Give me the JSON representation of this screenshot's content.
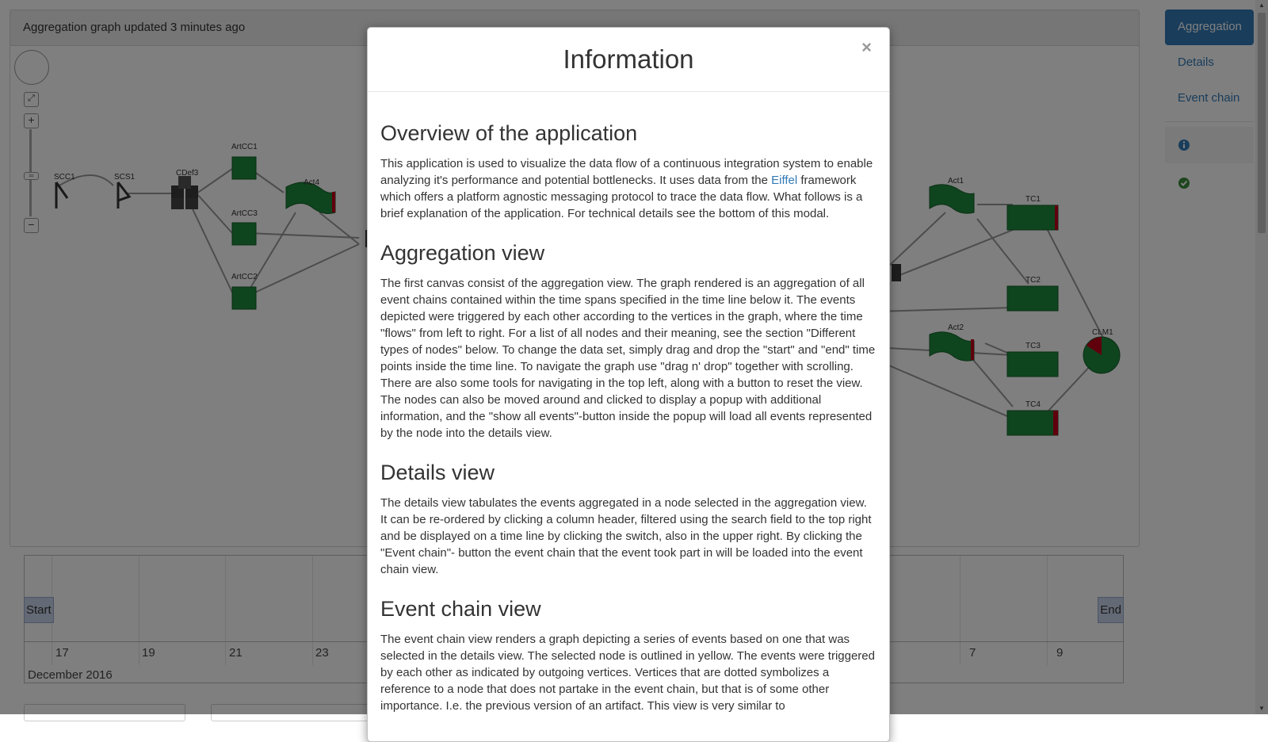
{
  "aggregation_panel": {
    "status": "Aggregation graph updated 3 minutes ago"
  },
  "graph_nodes": {
    "scc1": "SCC1",
    "scs1": "SCS1",
    "cdef3": "CDef3",
    "artcc1": "ArtCC1",
    "artcc3": "ArtCC3",
    "artcc2": "ArtCC2",
    "act4": "Act4",
    "act1": "Act1",
    "act2": "Act2",
    "tc1": "TC1",
    "tc2": "TC2",
    "tc3": "TC3",
    "tc4": "TC4",
    "clm1": "CLM1"
  },
  "timeline": {
    "start_label": "Start",
    "end_label": "End",
    "ticks": [
      "17",
      "19",
      "21",
      "23",
      "7",
      "9"
    ],
    "month": "December 2016"
  },
  "sidebar": {
    "items": [
      {
        "label": "Aggregation",
        "active": true
      },
      {
        "label": "Details",
        "active": false
      },
      {
        "label": "Event chain",
        "active": false
      }
    ],
    "icons": [
      "info-icon",
      "check-circle-icon"
    ]
  },
  "modal": {
    "title": "Information",
    "close": "×",
    "sections": [
      {
        "heading": "Overview of the application",
        "text_before_link": "This application is used to visualize the data flow of a continuous integration system to enable analyzing it's performance and potential bottlenecks. It uses data from the ",
        "link": "Eiffel",
        "text_after_link": " framework which offers a platform agnostic messaging protocol to trace the data flow. What follows is a brief explanation of the application. For technical details see the bottom of this modal."
      },
      {
        "heading": "Aggregation view",
        "text": "The first canvas consist of the aggregation view. The graph rendered is an aggregation of all event chains contained within the time spans specified in the time line below it. The events depicted were triggered by each other according to the vertices in the graph, where the time \"flows\" from left to right. For a list of all nodes and their meaning, see the section \"Different types of nodes\" below. To change the data set, simply drag and drop the \"start\" and \"end\" time points inside the time line. To navigate the graph use \"drag n' drop\" together with scrolling. There are also some tools for navigating in the top left, along with a button to reset the view. The nodes can also be moved around and clicked to display a popup with additional information, and the \"show all events\"-button inside the popup will load all events represented by the node into the details view."
      },
      {
        "heading": "Details view",
        "text": "The details view tabulates the events aggregated in a node selected in the aggregation view. It can be re-ordered by clicking a column header, filtered using the search field to the top right and be displayed on a time line by clicking the switch, also in the upper right. By clicking the \"Event chain\"- button the event chain that the event took part in will be loaded into the event chain view."
      },
      {
        "heading": "Event chain view",
        "text": "The event chain view renders a graph depicting a series of events based on one that was selected in the details view. The selected node is outlined in yellow. The events were triggered by each other as indicated by outgoing vertices. Vertices that are dotted symbolizes a reference to a node that does not partake in the event chain, but that is of some other importance. I.e. the previous version of an artifact. This view is very similar to"
      }
    ]
  },
  "colors": {
    "brand": "#337ab7",
    "node_green": "#1f8a3d",
    "node_red": "#c0001a",
    "node_dark": "#3a3a3a"
  }
}
